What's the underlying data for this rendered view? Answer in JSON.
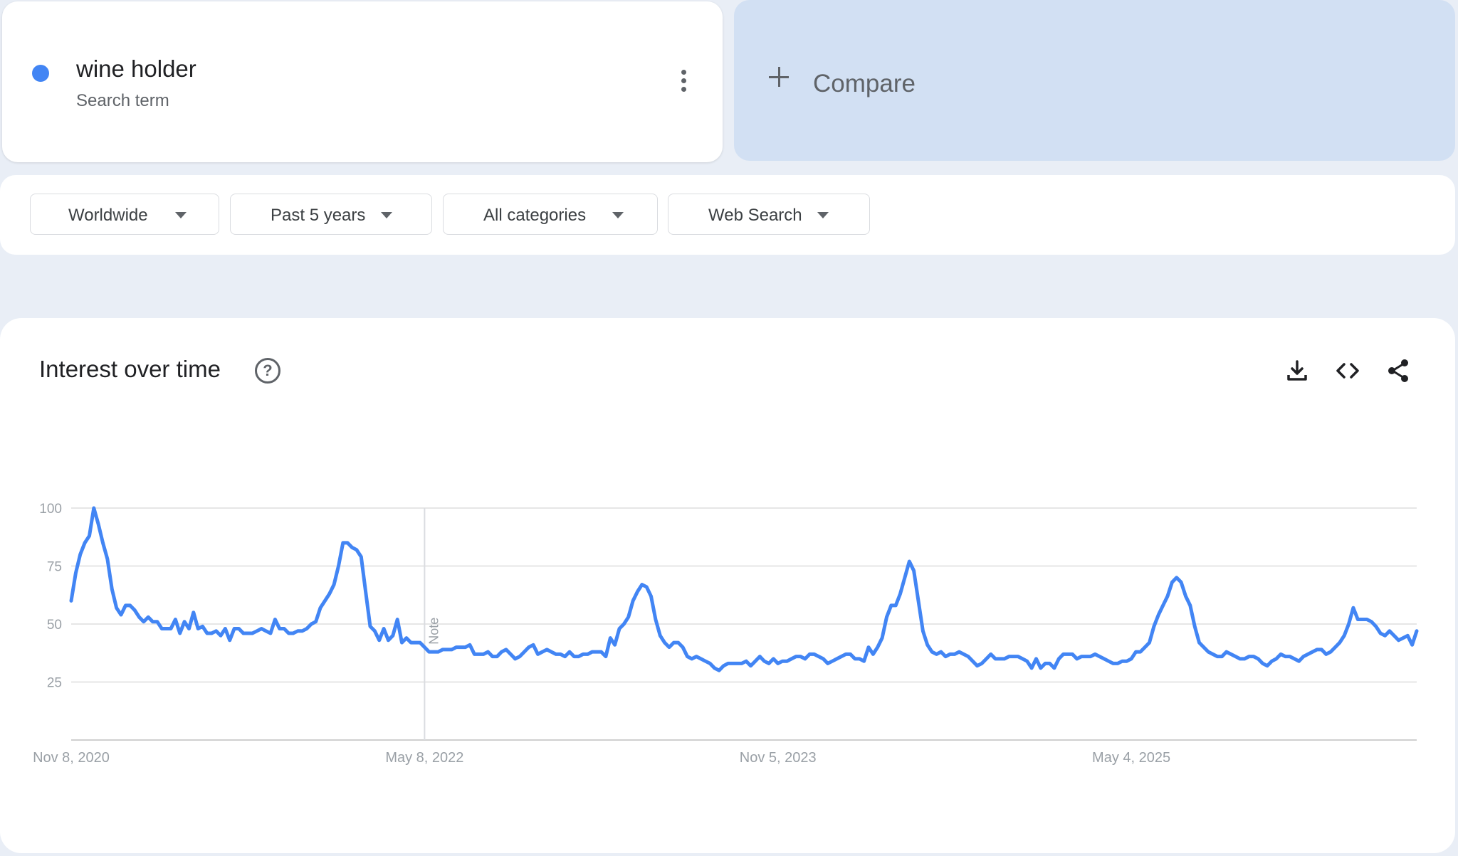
{
  "term": {
    "name": "wine holder",
    "type": "Search term",
    "color": "#4285f4"
  },
  "compare": {
    "label": "Compare"
  },
  "filters": [
    {
      "label": "Worldwide"
    },
    {
      "label": "Past 5 years"
    },
    {
      "label": "All categories"
    },
    {
      "label": "Web Search"
    }
  ],
  "chart_section": {
    "title": "Interest over time",
    "icons": [
      "help-icon",
      "download-icon",
      "embed-code-icon",
      "share-icon"
    ]
  },
  "chart_data": {
    "type": "line",
    "x_start": "Nov 8, 2020",
    "x_tick_labels": [
      "Nov 8, 2020",
      "May 8, 2022",
      "Nov 5, 2023",
      "May 4, 2025"
    ],
    "y_ticks": [
      100,
      75,
      50,
      25
    ],
    "ylim": [
      0,
      100
    ],
    "grid": true,
    "note_marker": {
      "label": "Note",
      "at_week": 78
    },
    "series": [
      {
        "color": "#4285f4",
        "values": [
          60,
          72,
          80,
          85,
          88,
          100,
          93,
          85,
          78,
          65,
          57,
          54,
          58,
          58,
          56,
          53,
          51,
          53,
          51,
          51,
          48,
          48,
          48,
          52,
          46,
          51,
          48,
          55,
          48,
          49,
          46,
          46,
          47,
          45,
          48,
          43,
          48,
          48,
          46,
          46,
          46,
          47,
          48,
          47,
          46,
          52,
          48,
          48,
          46,
          46,
          47,
          47,
          48,
          50,
          51,
          57,
          60,
          63,
          67,
          75,
          85,
          85,
          83,
          82,
          79,
          64,
          49,
          47,
          43,
          48,
          43,
          45,
          52,
          42,
          44,
          42,
          42,
          42,
          40,
          38,
          38,
          38,
          39,
          39,
          39,
          40,
          40,
          40,
          41,
          37,
          37,
          37,
          38,
          36,
          36,
          38,
          39,
          37,
          35,
          36,
          38,
          40,
          41,
          37,
          38,
          39,
          38,
          37,
          37,
          36,
          38,
          36,
          36,
          37,
          37,
          38,
          38,
          38,
          36,
          44,
          41,
          48,
          50,
          53,
          60,
          64,
          67,
          66,
          62,
          52,
          45,
          42,
          40,
          42,
          42,
          40,
          36,
          35,
          36,
          35,
          34,
          33,
          31,
          30,
          32,
          33,
          33,
          33,
          33,
          34,
          32,
          34,
          36,
          34,
          33,
          35,
          33,
          34,
          34,
          35,
          36,
          36,
          35,
          37,
          37,
          36,
          35,
          33,
          34,
          35,
          36,
          37,
          37,
          35,
          35,
          34,
          40,
          37,
          40,
          44,
          53,
          58,
          58,
          63,
          70,
          77,
          73,
          60,
          47,
          41,
          38,
          37,
          38,
          36,
          37,
          37,
          38,
          37,
          36,
          34,
          32,
          33,
          35,
          37,
          35,
          35,
          35,
          36,
          36,
          36,
          35,
          34,
          31,
          35,
          31,
          33,
          33,
          31,
          35,
          37,
          37,
          37,
          35,
          36,
          36,
          36,
          37,
          36,
          35,
          34,
          33,
          33,
          34,
          34,
          35,
          38,
          38,
          40,
          42,
          49,
          54,
          58,
          62,
          68,
          70,
          68,
          62,
          58,
          49,
          42,
          40,
          38,
          37,
          36,
          36,
          38,
          37,
          36,
          35,
          35,
          36,
          36,
          35,
          33,
          32,
          34,
          35,
          37,
          36,
          36,
          35,
          34,
          36,
          37,
          38,
          39,
          39,
          37,
          38,
          40,
          42,
          45,
          50,
          57,
          52,
          52,
          52,
          51,
          49,
          46,
          45,
          47,
          45,
          43,
          44,
          45,
          41,
          47
        ]
      }
    ]
  }
}
